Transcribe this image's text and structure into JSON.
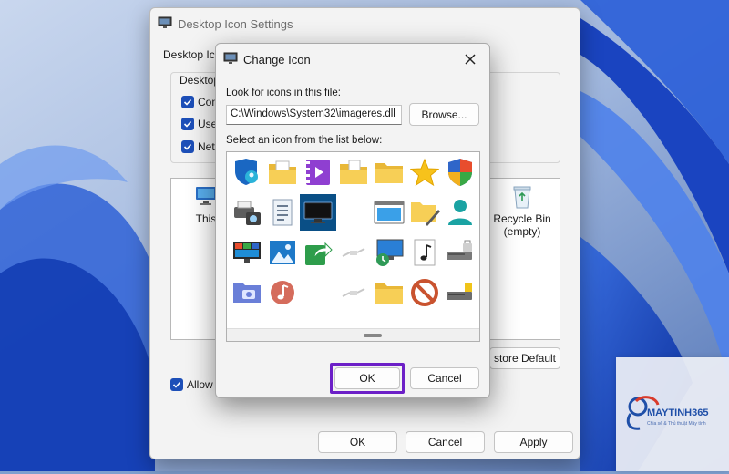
{
  "desktop_dialog": {
    "title": "Desktop Icon Settings",
    "tab_label": "Desktop Ic",
    "group_title": "Desktop",
    "checkboxes": [
      "Con",
      "Use",
      "Netv"
    ],
    "pane_items": [
      {
        "label": "This",
        "icon": "computer-icon"
      },
      {
        "label": "Recycle Bin\n(empty)",
        "icon": "recycle-bin-icon"
      }
    ],
    "restore_default_label": "store Default",
    "allow_label": "Allow",
    "ok_label": "OK",
    "cancel_label": "Cancel",
    "apply_label": "Apply"
  },
  "change_icon_dialog": {
    "title": "Change Icon",
    "look_for_label": "Look for icons in this file:",
    "file_path": "C:\\Windows\\System32\\imageres.dll",
    "browse_label": "Browse...",
    "select_label": "Select an icon from the list below:",
    "selected_icon": "monitor-dark-icon",
    "icons": [
      [
        "shield-user-icon",
        "folder-doc-icon",
        "video-folder-icon",
        "folder-doc2-icon",
        "folder-icon",
        "star-icon",
        "security-shield-icon"
      ],
      [
        "printer-scan-icon",
        "document-icon",
        "monitor-dark-icon",
        "blank-icon",
        "window-icon",
        "folder-pencil-icon",
        "user-icon"
      ],
      [
        "monitor-color-icon",
        "picture-icon",
        "share-arrow-icon",
        "cable-icon",
        "monitor-clock-icon",
        "music-note-icon",
        "drive-lock-icon"
      ],
      [
        "folder-camera-icon",
        "music-disc-icon",
        "blank-icon",
        "cable-icon",
        "folder-icon",
        "no-sign-icon",
        "drive-usb-icon"
      ]
    ],
    "ok_label": "OK",
    "cancel_label": "Cancel"
  },
  "watermark": {
    "brand": "MAYTINH365",
    "tagline": "Chia sẻ & Thủ thuật Máy tính"
  },
  "colors": {
    "accent": "#1d4fb8",
    "highlight": "#6c1fc7",
    "selection": "#0a4f86"
  }
}
